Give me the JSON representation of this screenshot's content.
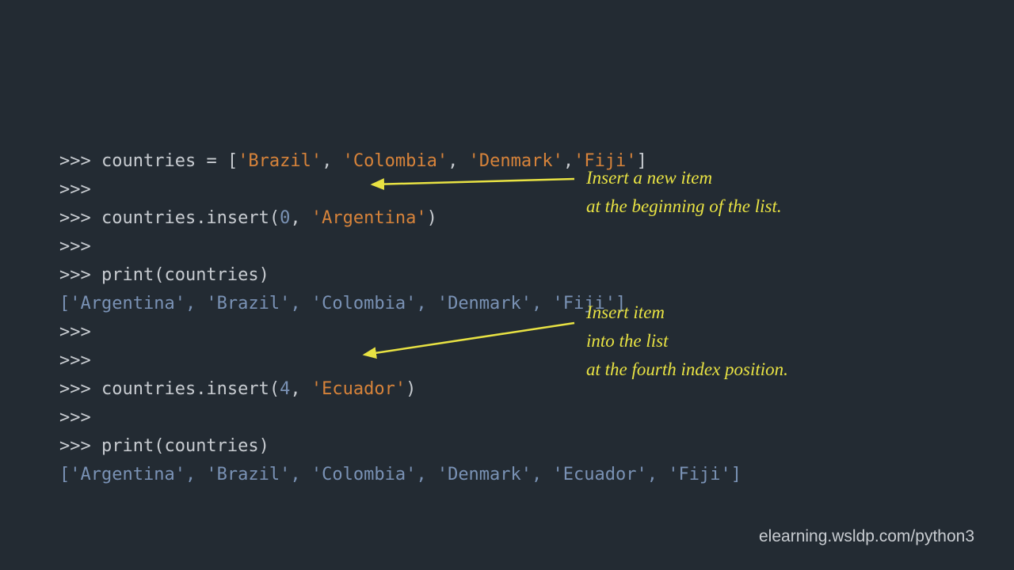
{
  "code": {
    "l1": {
      "prompt": ">>> ",
      "var": "countries",
      "eq": " = [",
      "s1": "'Brazil'",
      "c1": ", ",
      "s2": "'Colombia'",
      "c2": ", ",
      "s3": "'Denmark'",
      "c3": ",",
      "s4": "'Fiji'",
      "close": "]"
    },
    "l2": ">>>",
    "l3": {
      "prompt": ">>> ",
      "call": "countries.insert(",
      "num": "0",
      "comma": ", ",
      "arg": "'Argentina'",
      "close": ")"
    },
    "l4": ">>>",
    "l5": {
      "prompt": ">>> ",
      "call": "print(countries)"
    },
    "l6": "['Argentina', 'Brazil', 'Colombia', 'Denmark', 'Fiji']",
    "l7": ">>>",
    "l8": ">>>",
    "l9": {
      "prompt": ">>> ",
      "call": "countries.insert(",
      "num": "4",
      "comma": ", ",
      "arg": "'Ecuador'",
      "close": ")"
    },
    "l10": ">>>",
    "l11": {
      "prompt": ">>> ",
      "call": "print(countries)"
    },
    "l12": "['Argentina', 'Brazil', 'Colombia', 'Denmark', 'Ecuador', 'Fiji']"
  },
  "annot1": {
    "line1": "Insert a new item",
    "line2": "at the beginning of the list."
  },
  "annot2": {
    "line1": "Insert item",
    "line2": "into the list",
    "line3": "at the fourth index position."
  },
  "footer": "elearning.wsldp.com/python3",
  "arrow_color": "#e8e243"
}
